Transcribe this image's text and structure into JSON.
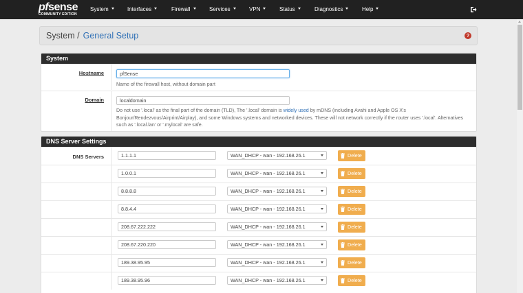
{
  "brand": {
    "logo_text_pf": "pf",
    "logo_text_sense": "sense",
    "logo_sub": "COMMUNITY EDITION"
  },
  "nav": {
    "items": [
      {
        "label": "System"
      },
      {
        "label": "Interfaces"
      },
      {
        "label": "Firewall"
      },
      {
        "label": "Services"
      },
      {
        "label": "VPN"
      },
      {
        "label": "Status"
      },
      {
        "label": "Diagnostics"
      },
      {
        "label": "Help"
      }
    ],
    "logout_icon": "logout-icon"
  },
  "breadcrumb": {
    "section": "System /",
    "page": "General Setup",
    "help_icon": "?"
  },
  "system_panel": {
    "heading": "System",
    "hostname": {
      "label": "Hostname",
      "value": "pfSense",
      "help": "Name of the firewall host, without domain part"
    },
    "domain": {
      "label": "Domain",
      "value": "localdomain",
      "help_pre": "Do not use '.local' as the final part of the domain (TLD), The '.local' domain is ",
      "help_link": "widely used",
      "help_post": " by mDNS (including Avahi and Apple OS X's Bonjour/Rendezvous/Airprint/Airplay), and some Windows systems and networked devices. These will not network correctly if the router uses '.local'. Alternatives such as '.local.lan' or '.mylocal' are safe."
    }
  },
  "dns_panel": {
    "heading": "DNS Server Settings",
    "label": "DNS Servers",
    "delete_label": "Delete",
    "servers": [
      {
        "ip": "1.1.1.1",
        "gateway": "WAN_DHCP - wan - 192.168.26.1"
      },
      {
        "ip": "1.0.0.1",
        "gateway": "WAN_DHCP - wan - 192.168.26.1"
      },
      {
        "ip": "8.8.8.8",
        "gateway": "WAN_DHCP - wan - 192.168.26.1"
      },
      {
        "ip": "8.8.4.4",
        "gateway": "WAN_DHCP - wan - 192.168.26.1"
      },
      {
        "ip": "208.67.222.222",
        "gateway": "WAN_DHCP - wan - 192.168.26.1"
      },
      {
        "ip": "208.67.220.220",
        "gateway": "WAN_DHCP - wan - 192.168.26.1"
      },
      {
        "ip": "189.38.95.95",
        "gateway": "WAN_DHCP - wan - 192.168.26.1"
      },
      {
        "ip": "189.38.95.96",
        "gateway": "WAN_DHCP - wan - 192.168.26.1"
      }
    ]
  },
  "colors": {
    "navbar": "#212121",
    "panel_heading": "#2d2d2d",
    "link": "#3171b6",
    "delete_button": "#f0ad4e",
    "help_icon": "#c0392b"
  }
}
